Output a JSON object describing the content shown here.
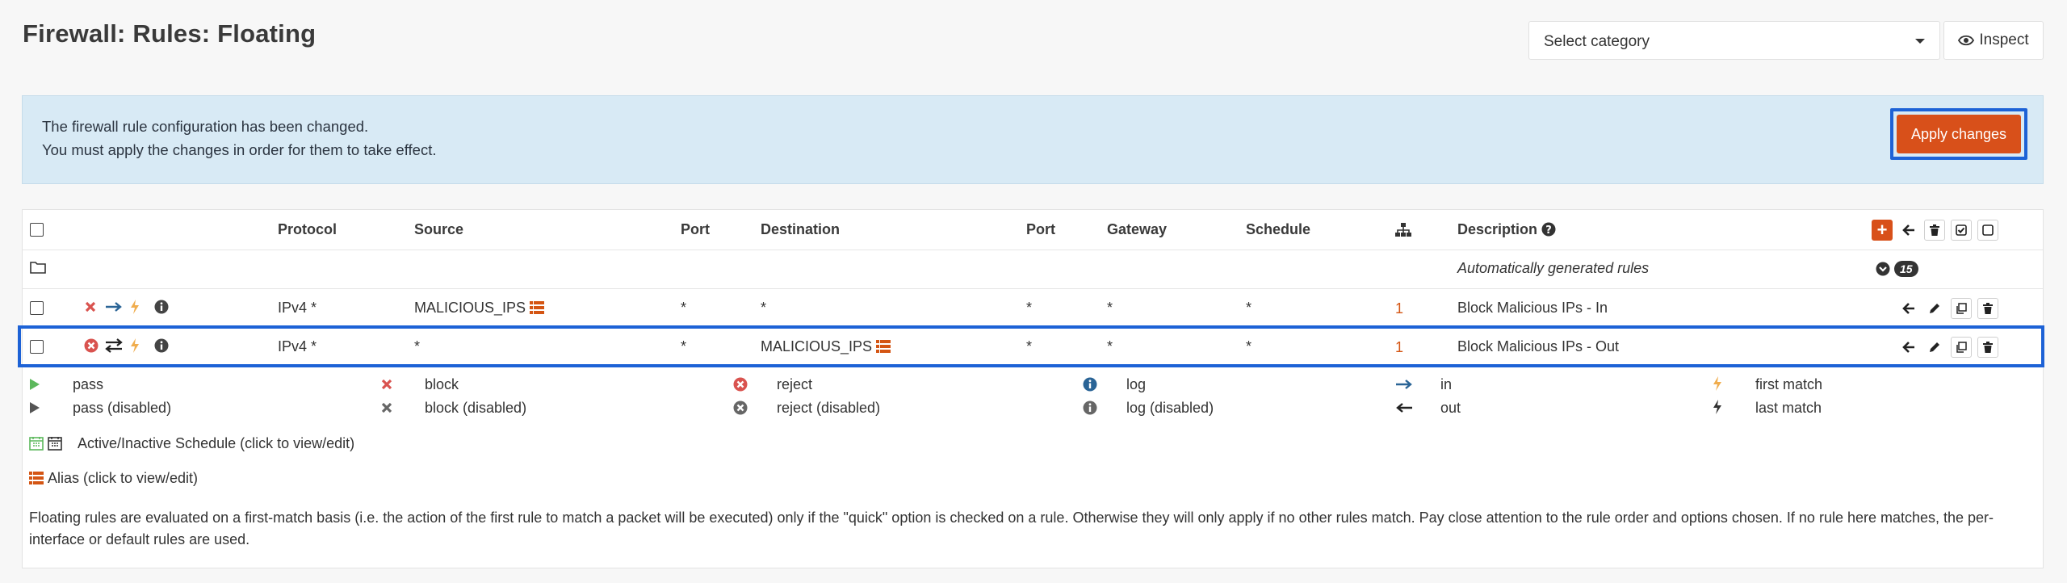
{
  "header": {
    "title": "Firewall: Rules: Floating",
    "category_select": "Select category",
    "inspect_label": "Inspect"
  },
  "alert": {
    "line1": "The firewall rule configuration has been changed.",
    "line2": "You must apply the changes in order for them to take effect.",
    "apply_label": "Apply changes"
  },
  "table": {
    "headers": {
      "protocol": "Protocol",
      "source": "Source",
      "port": "Port",
      "destination": "Destination",
      "port2": "Port",
      "gateway": "Gateway",
      "schedule": "Schedule",
      "description": "Description"
    },
    "auto_rules": {
      "label": "Automatically generated rules",
      "count": "15"
    },
    "rows": [
      {
        "protocol": "IPv4 *",
        "source": "MALICIOUS_IPS",
        "port": "*",
        "destination": "*",
        "port2": "*",
        "gateway": "*",
        "schedule": "*",
        "evaluations": "1",
        "description": "Block Malicious IPs - In"
      },
      {
        "protocol": "IPv4 *",
        "source": "*",
        "port": "*",
        "destination": "MALICIOUS_IPS",
        "port2": "*",
        "gateway": "*",
        "schedule": "*",
        "evaluations": "1",
        "description": "Block Malicious IPs - Out"
      }
    ]
  },
  "legend": {
    "pass": "pass",
    "pass_disabled": "pass (disabled)",
    "block": "block",
    "block_disabled": "block (disabled)",
    "reject": "reject",
    "reject_disabled": "reject (disabled)",
    "log": "log",
    "log_disabled": "log (disabled)",
    "in": "in",
    "out": "out",
    "first_match": "first match",
    "last_match": "last match",
    "schedule": "Active/Inactive Schedule (click to view/edit)",
    "alias": "Alias (click to view/edit)"
  },
  "footer_text": "Floating rules are evaluated on a first-match basis (i.e. the action of the first rule to match a packet will be executed) only if the \"quick\" option is checked on a rule. Otherwise they will only apply if no other rules match. Pay close attention to the rule order and options chosen. If no rule here matches, the per-interface or default rules are used.",
  "colors": {
    "accent": "#d8501a",
    "highlight": "#1d62d6",
    "alert_bg": "#d8eaf5",
    "block_red": "#d9534f",
    "pass_green": "#5cb85c",
    "arrow_blue": "#2a6496"
  }
}
